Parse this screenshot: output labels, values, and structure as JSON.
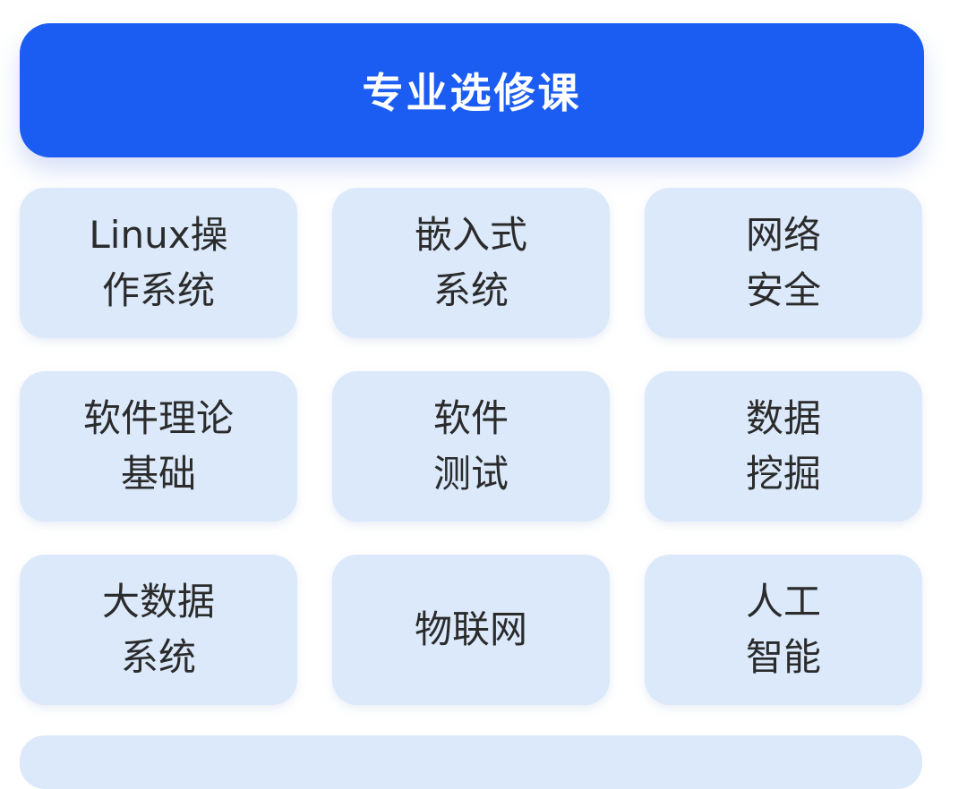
{
  "header": {
    "title": "专业选修课"
  },
  "courses": [
    {
      "line1": "Linux操",
      "line2": "作系统"
    },
    {
      "line1": "嵌入式",
      "line2": "系统"
    },
    {
      "line1": "网络",
      "line2": "安全"
    },
    {
      "line1": "软件理论",
      "line2": "基础"
    },
    {
      "line1": "软件",
      "line2": "测试"
    },
    {
      "line1": "数据",
      "line2": "挖掘"
    },
    {
      "line1": "大数据",
      "line2": "系统"
    },
    {
      "line1": "物联网",
      "line2": ""
    },
    {
      "line1": "人工",
      "line2": "智能"
    }
  ],
  "colors": {
    "header_bg": "#1b5cf2",
    "card_bg": "#dbe9fb",
    "text": "#2b2b2b"
  }
}
